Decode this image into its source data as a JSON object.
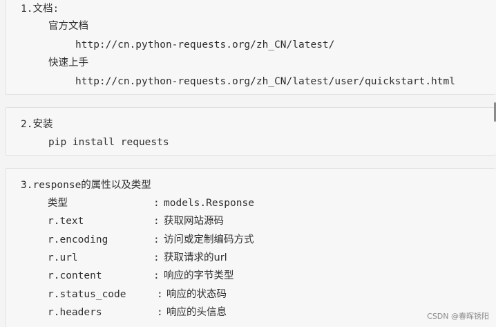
{
  "section1": {
    "heading": "1.文档:",
    "doc_label": "官方文档",
    "doc_url": "http://cn.python-requests.org/zh_CN/latest/",
    "quick_label": "快速上手",
    "quick_url": "http://cn.python-requests.org/zh_CN/latest/user/quickstart.html"
  },
  "section2": {
    "heading": "2.安装",
    "command": "pip install requests"
  },
  "section3": {
    "heading": "3.response的属性以及类型",
    "rows": [
      {
        "name": "类型",
        "sep": ":",
        "desc": "models.Response"
      },
      {
        "name": "r.text",
        "sep": ":",
        "desc": "获取网站源码"
      },
      {
        "name": "r.encoding",
        "sep": ":",
        "desc": "访问或定制编码方式"
      },
      {
        "name": "r.url",
        "sep": ":",
        "desc": "获取请求的url"
      },
      {
        "name": "r.content",
        "sep": ":",
        "desc": "响应的字节类型"
      },
      {
        "name": "r.status_code",
        "sep": ":",
        "desc": "响应的状态码"
      },
      {
        "name": "r.headers",
        "sep": ":",
        "desc": "响应的头信息"
      }
    ]
  },
  "watermark": "CSDN @春晖锈阳"
}
